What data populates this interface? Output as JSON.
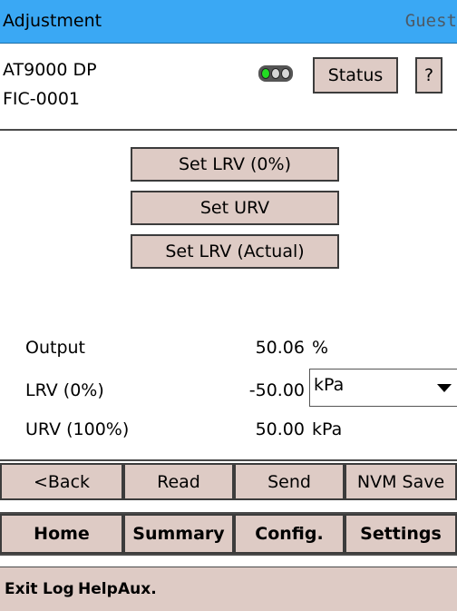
{
  "titlebar": {
    "title": "Adjustment",
    "user": "Guest"
  },
  "device": {
    "model": "AT9000 DP",
    "tag": "FIC-0001",
    "status_label": "Status",
    "help_label": "?",
    "indicator_icon": "status-lights-icon",
    "indicator_color": "#22dd22"
  },
  "actions": {
    "set_lrv": "Set LRV (0%)",
    "set_urv": "Set URV",
    "set_lrv_actual": "Set LRV (Actual)"
  },
  "readings": {
    "output": {
      "label": "Output",
      "value": "50.06",
      "unit": "%"
    },
    "lrv": {
      "label": "LRV (0%)",
      "value": "-50.00",
      "unit": "kPa",
      "unit_options": [
        "kPa"
      ]
    },
    "urv": {
      "label": "URV (100%)",
      "value": "50.00",
      "unit": "kPa"
    }
  },
  "commands": {
    "back": "<Back",
    "read": "Read",
    "send": "Send",
    "nvm_save": "NVM Save"
  },
  "nav": {
    "home": "Home",
    "summary": "Summary",
    "config": "Config.",
    "settings": "Settings"
  },
  "menu": {
    "exit": "Exit",
    "log": "Log",
    "help": "Help",
    "aux": "Aux."
  },
  "colors": {
    "titlebar": "#3aa8f4",
    "button": "#decbc5",
    "led_on": "#22dd22"
  }
}
